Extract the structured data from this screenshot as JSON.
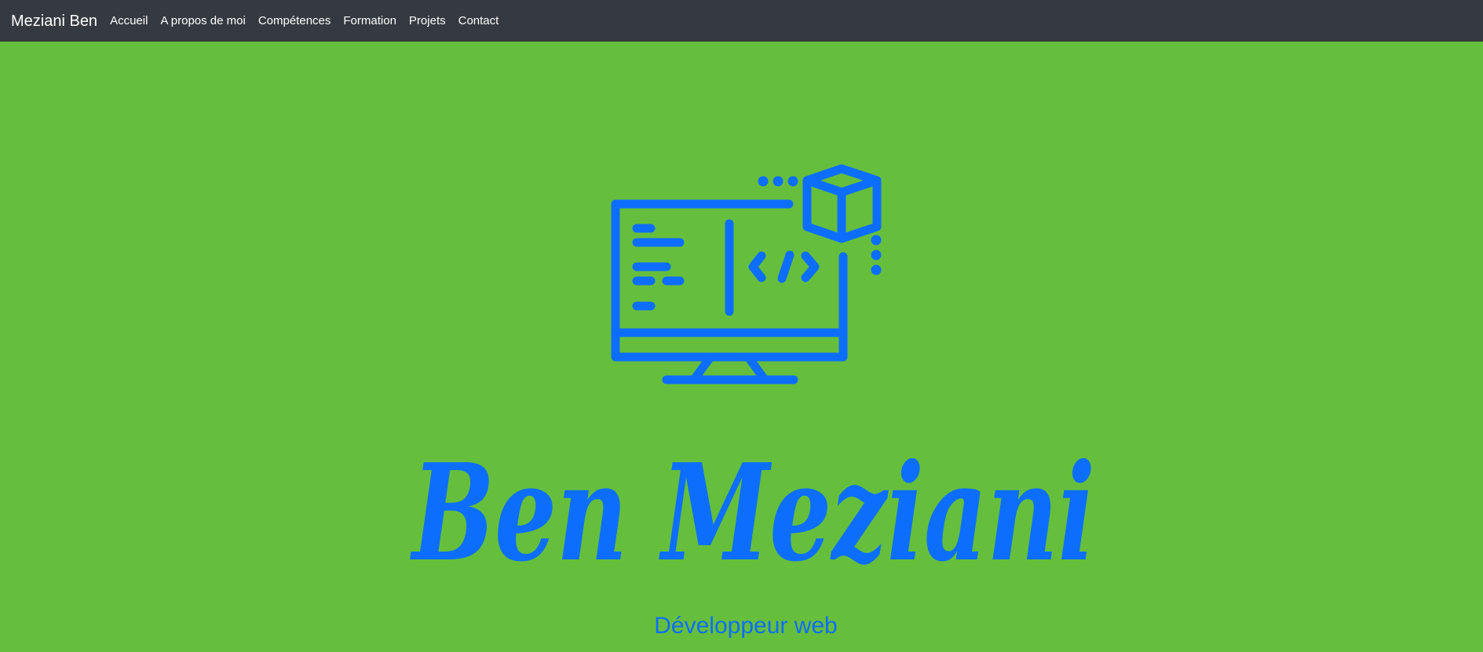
{
  "nav": {
    "brand": "Meziani Ben",
    "links": [
      {
        "label": "Accueil"
      },
      {
        "label": "A propos de moi"
      },
      {
        "label": "Compétences"
      },
      {
        "label": "Formation"
      },
      {
        "label": "Projets"
      },
      {
        "label": "Contact"
      }
    ]
  },
  "hero": {
    "name": "Ben Meziani",
    "tagline": "Développeur web",
    "icon": "monitor-code-cube-icon"
  },
  "colors": {
    "background": "#66bf3c",
    "navbar": "#343a40",
    "accent": "#0d6efd",
    "nav_text": "#ffffff"
  }
}
